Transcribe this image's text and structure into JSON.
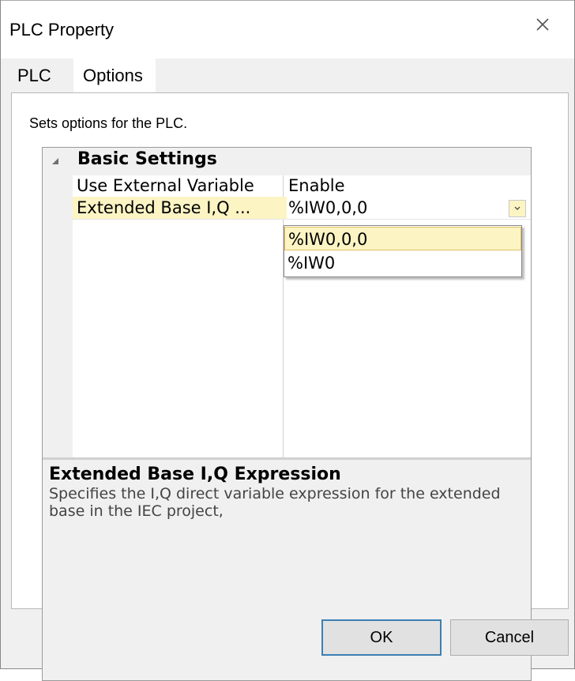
{
  "window": {
    "title": "PLC Property"
  },
  "tabs": [
    {
      "label": "PLC",
      "selected": false
    },
    {
      "label": "Options",
      "selected": true
    }
  ],
  "panel": {
    "description": "Sets options for the PLC."
  },
  "property_grid": {
    "category": "Basic Settings",
    "rows": [
      {
        "name": "Use External Variable",
        "value": "Enable"
      },
      {
        "name": "Extended Base I,Q ...",
        "value": "%IW0,0,0"
      }
    ],
    "dropdown_options": [
      "%IW0,0,0",
      "%IW0"
    ],
    "selected_option": "%IW0,0,0"
  },
  "help": {
    "title": "Extended Base I,Q Expression",
    "description": "Specifies the I,Q direct variable expression for the extended base in the IEC project,"
  },
  "buttons": {
    "ok": "OK",
    "cancel": "Cancel"
  },
  "colors": {
    "highlight": "#fdf4c4",
    "ok_border": "#3c7fb1"
  },
  "icons": {
    "close": "close-icon",
    "collapse": "collapse-triangle-icon",
    "dropdown": "chevron-down-icon"
  }
}
